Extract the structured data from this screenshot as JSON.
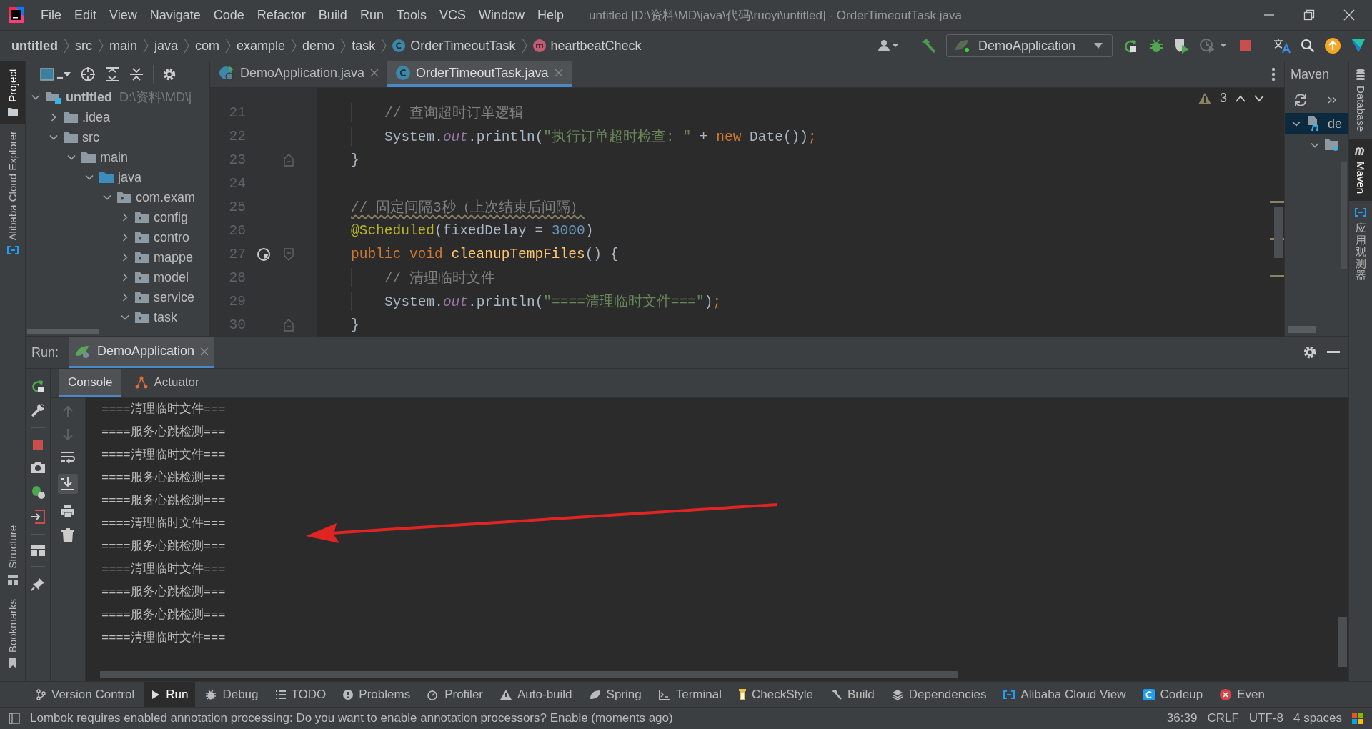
{
  "window": {
    "title": "untitled [D:\\资料\\MD\\java\\代码\\ruoyi\\untitled] - OrderTimeoutTask.java"
  },
  "menu": [
    "File",
    "Edit",
    "View",
    "Navigate",
    "Code",
    "Refactor",
    "Build",
    "Run",
    "Tools",
    "VCS",
    "Window",
    "Help"
  ],
  "breadcrumbs": [
    {
      "label": "untitled",
      "kind": "project"
    },
    {
      "label": "src",
      "kind": "dir"
    },
    {
      "label": "main",
      "kind": "dir"
    },
    {
      "label": "java",
      "kind": "dir"
    },
    {
      "label": "com",
      "kind": "dir"
    },
    {
      "label": "example",
      "kind": "dir"
    },
    {
      "label": "demo",
      "kind": "dir"
    },
    {
      "label": "task",
      "kind": "dir"
    },
    {
      "label": "OrderTimeoutTask",
      "kind": "class"
    },
    {
      "label": "heartbeatCheck",
      "kind": "method"
    }
  ],
  "run_config": {
    "label": "DemoApplication"
  },
  "left_strip": {
    "top": [
      {
        "label": "Project",
        "selected": true,
        "kind": "folder"
      },
      {
        "label": "Alibaba Cloud Explorer",
        "selected": false,
        "kind": "cloud"
      }
    ],
    "bottom": [
      {
        "label": "Structure",
        "selected": false,
        "kind": "structure"
      },
      {
        "label": "Bookmarks",
        "selected": false,
        "kind": "bookmark"
      }
    ]
  },
  "right_strip": [
    {
      "label": "Database",
      "selected": false,
      "kind": "database",
      "vertical_cjk": false
    },
    {
      "label": "Maven",
      "selected": true,
      "kind": "maven",
      "vertical_cjk": false
    },
    {
      "label": "应用观测器",
      "selected": false,
      "kind": "cloud",
      "vertical_cjk": true
    }
  ],
  "project_tree": {
    "items": [
      {
        "label": "untitled",
        "hint": "D:\\资料\\MD\\j",
        "kind": "module",
        "expanded": true,
        "children": [
          {
            "label": ".idea",
            "kind": "folder",
            "expanded": false
          },
          {
            "label": "src",
            "kind": "folder",
            "expanded": true,
            "children": [
              {
                "label": "main",
                "kind": "folder",
                "expanded": true,
                "children": [
                  {
                    "label": "java",
                    "kind": "source",
                    "expanded": true,
                    "children": [
                      {
                        "label": "com.exam",
                        "kind": "package",
                        "expanded": true,
                        "children": [
                          {
                            "label": "config",
                            "kind": "package",
                            "expanded": false
                          },
                          {
                            "label": "contro",
                            "kind": "package",
                            "expanded": false
                          },
                          {
                            "label": "mappe",
                            "kind": "package",
                            "expanded": false
                          },
                          {
                            "label": "model",
                            "kind": "package",
                            "expanded": false
                          },
                          {
                            "label": "service",
                            "kind": "package",
                            "expanded": false
                          },
                          {
                            "label": "task",
                            "kind": "package",
                            "expanded": true
                          }
                        ]
                      }
                    ]
                  }
                ]
              }
            ]
          }
        ]
      }
    ]
  },
  "editor": {
    "tabs": [
      {
        "label": "DemoApplication.java",
        "kind": "spring",
        "selected": false
      },
      {
        "label": "OrderTimeoutTask.java",
        "kind": "class",
        "selected": true
      }
    ],
    "warnings": "3",
    "lines": [
      {
        "number": "21",
        "nested": true,
        "kind": "code",
        "tokens": [
          {
            "text": "// 查询超时订单逻辑",
            "kind": "comment"
          }
        ]
      },
      {
        "number": "22",
        "nested": true,
        "kind": "code",
        "tokens": [
          {
            "text": "System.",
            "kind": "plain"
          },
          {
            "text": "out",
            "kind": "field"
          },
          {
            "text": ".println(",
            "kind": "plain"
          },
          {
            "text": "\"执行订单超时检查: \"",
            "kind": "string"
          },
          {
            "text": " + ",
            "kind": "plain"
          },
          {
            "text": "new",
            "kind": "keyword"
          },
          {
            "text": " Date())",
            "kind": "plain"
          },
          {
            "text": ";",
            "kind": "keyword"
          }
        ]
      },
      {
        "number": "23",
        "nested": false,
        "kind": "block_end",
        "tokens": [
          {
            "text": "}",
            "kind": "plain"
          }
        ]
      },
      {
        "number": "24",
        "kind": "code"
      },
      {
        "number": "25",
        "nested": false,
        "kind": "code",
        "tokens": [
          {
            "text": "// 固定间隔3秒（上次结束后间隔）",
            "kind": "comment",
            "warning": true
          }
        ]
      },
      {
        "number": "26",
        "nested": false,
        "kind": "code",
        "tokens": [
          {
            "text": "@Scheduled",
            "kind": "annotation"
          },
          {
            "text": "(fixedDelay = ",
            "kind": "plain"
          },
          {
            "text": "3000",
            "kind": "number"
          },
          {
            "text": ")",
            "kind": "plain"
          }
        ]
      },
      {
        "number": "27",
        "nested": false,
        "kind": "scheduled_method",
        "tokens": [
          {
            "text": "public void",
            "kind": "keyword"
          },
          {
            "text": " cleanupTempFiles",
            "kind": "method"
          },
          {
            "text": "() {",
            "kind": "plain"
          }
        ]
      },
      {
        "number": "28",
        "nested": true,
        "kind": "code",
        "tokens": [
          {
            "text": "// 清理临时文件",
            "kind": "comment"
          }
        ]
      },
      {
        "number": "29",
        "nested": true,
        "kind": "code",
        "tokens": [
          {
            "text": "System.",
            "kind": "plain"
          },
          {
            "text": "out",
            "kind": "field"
          },
          {
            "text": ".println(",
            "kind": "plain"
          },
          {
            "text": "\"====清理临时文件===\"",
            "kind": "string"
          },
          {
            "text": ")",
            "kind": "plain"
          },
          {
            "text": ";",
            "kind": "keyword"
          }
        ]
      },
      {
        "number": "30",
        "nested": false,
        "kind": "block_end",
        "tokens": [
          {
            "text": "}",
            "kind": "plain"
          }
        ]
      }
    ]
  },
  "maven": {
    "title": "Maven",
    "items": [
      {
        "label": "de",
        "selected": true,
        "expanded": true,
        "children": [
          {
            "kind": "config_folder",
            "expanded": true
          }
        ]
      }
    ]
  },
  "run_panel": {
    "label": "Run:",
    "tab": "DemoApplication",
    "subtabs": [
      {
        "label": "Console",
        "kind": "console",
        "selected": true
      },
      {
        "label": "Actuator",
        "kind": "actuator",
        "selected": false
      }
    ],
    "console": [
      "====清理临时文件===",
      "====服务心跳检测===",
      "====清理临时文件===",
      "====服务心跳检测===",
      "====服务心跳检测===",
      "====清理临时文件===",
      "====服务心跳检测===",
      "====清理临时文件===",
      "====服务心跳检测===",
      "====服务心跳检测===",
      "====清理临时文件==="
    ]
  },
  "tool_windows": [
    {
      "label": "Version Control",
      "kind": "vcs",
      "selected": false
    },
    {
      "label": "Run",
      "kind": "run",
      "selected": true
    },
    {
      "label": "Debug",
      "kind": "debug",
      "selected": false
    },
    {
      "label": "TODO",
      "kind": "todo",
      "selected": false
    },
    {
      "label": "Problems",
      "kind": "problems",
      "selected": false
    },
    {
      "label": "Profiler",
      "kind": "profiler",
      "selected": false
    },
    {
      "label": "Auto-build",
      "kind": "warning",
      "selected": false
    },
    {
      "label": "Spring",
      "kind": "spring",
      "selected": false
    },
    {
      "label": "Terminal",
      "kind": "terminal",
      "selected": false
    },
    {
      "label": "CheckStyle",
      "kind": "checkstyle",
      "selected": false
    },
    {
      "label": "Build",
      "kind": "build",
      "selected": false
    },
    {
      "label": "Dependencies",
      "kind": "dependencies",
      "selected": false
    },
    {
      "label": "Alibaba Cloud View",
      "kind": "cloud",
      "selected": false
    },
    {
      "label": "Codeup",
      "kind": "codeup",
      "selected": false
    },
    {
      "label": "Even",
      "kind": "event",
      "selected": false
    }
  ],
  "status_bar": {
    "message": "Lombok requires enabled annotation processing: Do you want to enable annotation processors? Enable (moments ago)",
    "items": [
      "36:39",
      "CRLF",
      "UTF-8",
      "4 spaces"
    ]
  }
}
